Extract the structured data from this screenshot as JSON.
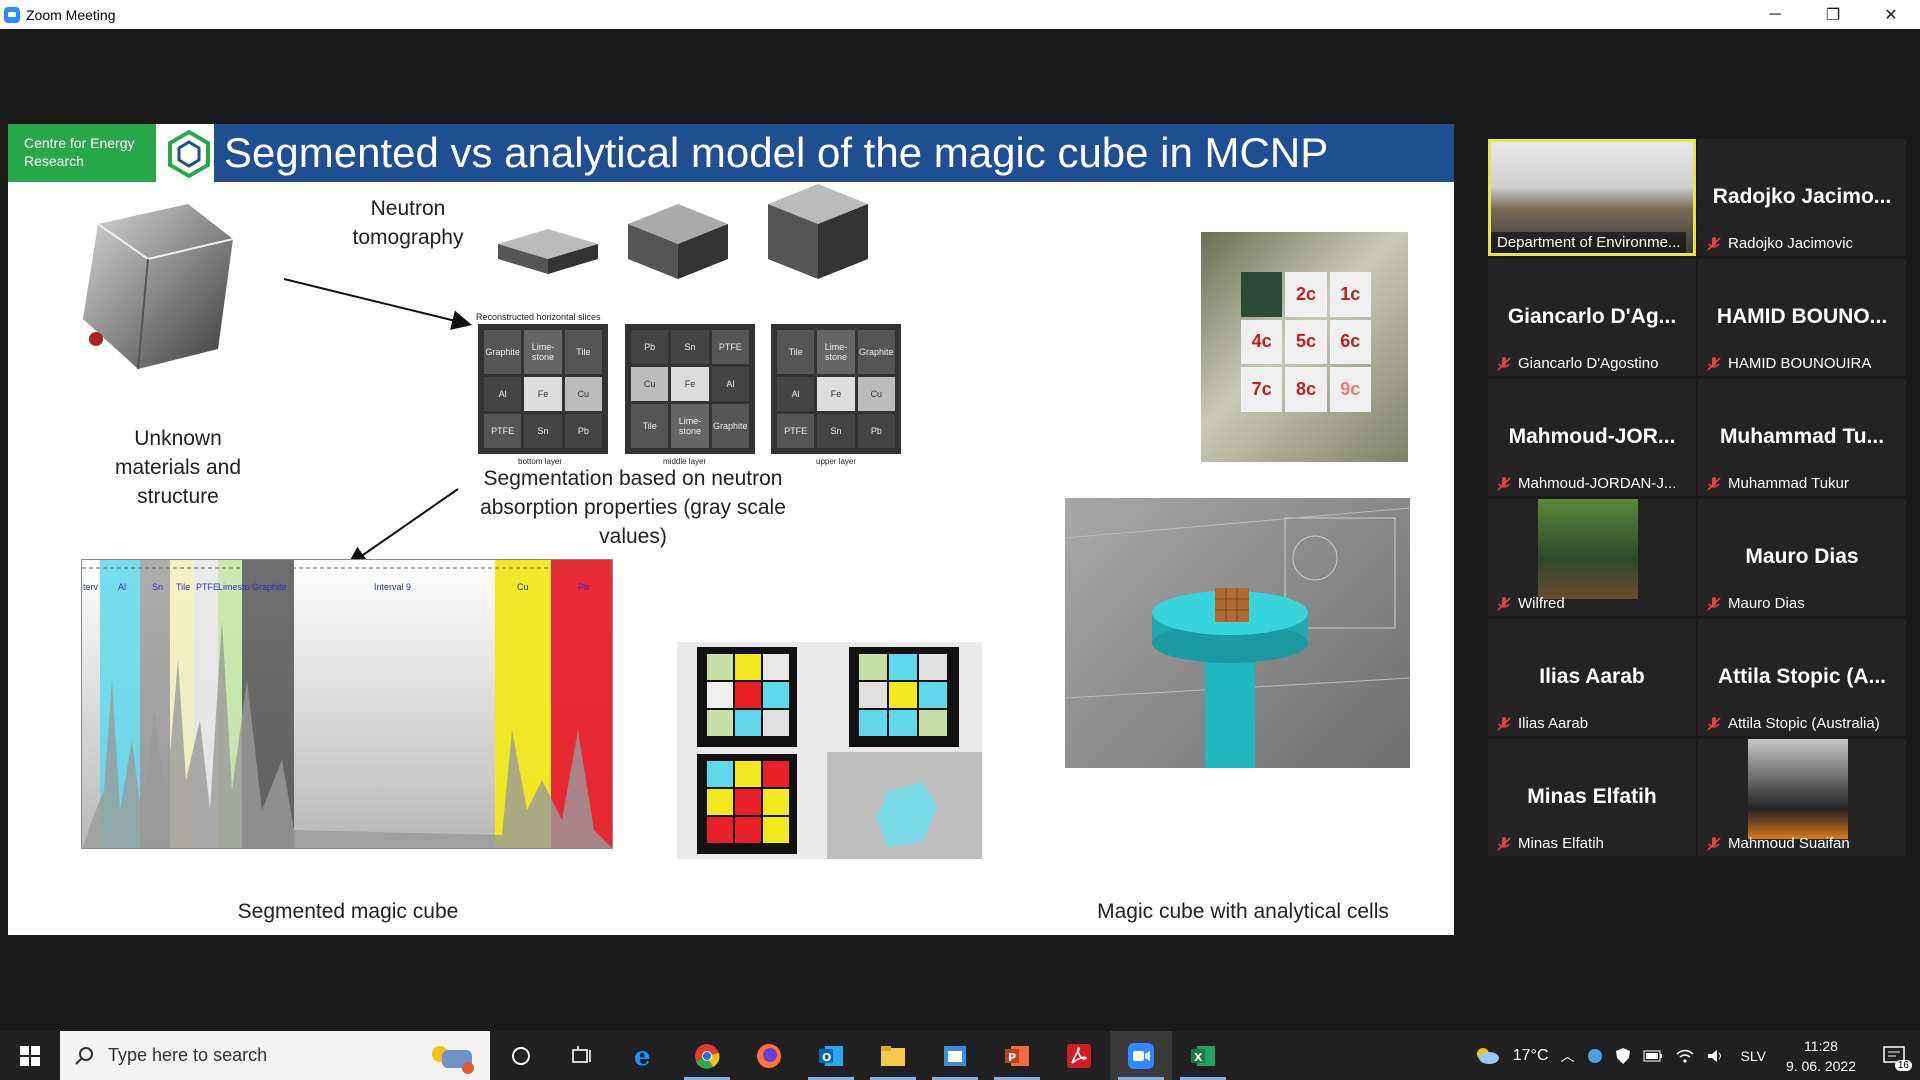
{
  "window": {
    "title": "Zoom Meeting",
    "controls": {
      "minimize": "─",
      "restore": "❐",
      "close": "✕"
    }
  },
  "slide": {
    "org_badge": "Centre for Energy Research",
    "title": "Segmented vs analytical model of the magic cube in MCNP",
    "neutron_tomography": "Neutron tomography",
    "unknown_materials": "Unknown materials and structure",
    "reconstructed_slices": "Reconstructed horizontal slices",
    "segmentation_text": "Segmentation based on neutron absorption properties (gray scale values)",
    "layers": [
      "bottom layer",
      "middle layer",
      "upper layer"
    ],
    "grid_bottom": [
      "Graphite",
      "Lime-stone",
      "Tile",
      "Al",
      "Fe",
      "Cu",
      "PTFE",
      "Sn",
      "Pb"
    ],
    "grid_middle": [
      "Pb",
      "Sn",
      "PTFE",
      "Cu",
      "Fe",
      "Al",
      "Tile",
      "Lime-stone",
      "Graphite"
    ],
    "grid_upper": [
      "Tile",
      "Lime-stone",
      "Graphite",
      "Al",
      "Fe",
      "Cu",
      "PTFE",
      "Sn",
      "Pb"
    ],
    "histogram_labels": [
      "terv",
      "Al",
      "Sn",
      "Tile",
      "PTFE",
      "Limesto",
      "Graphite",
      "Interval 9",
      "Cu",
      "Pb"
    ],
    "cube_labels": [
      "2c",
      "1c",
      "4c",
      "5c",
      "6c",
      "7c",
      "8c",
      "9c"
    ],
    "segmented_caption": "Segmented magic cube",
    "analytical_caption": "Magic cube with analytical cells"
  },
  "participants": [
    {
      "big": "",
      "name": "Department of Environme...",
      "video": true,
      "active": true,
      "muted": false
    },
    {
      "big": "Radojko Jacimo...",
      "name": "Radojko Jacimovic",
      "video": false,
      "muted": true
    },
    {
      "big": "Giancarlo D'Ag...",
      "name": "Giancarlo D'Agostino",
      "video": false,
      "muted": true
    },
    {
      "big": "HAMID BOUNO...",
      "name": "HAMID BOUNOUIRA",
      "video": false,
      "muted": true
    },
    {
      "big": "Mahmoud-JOR...",
      "name": "Mahmoud-JORDAN-J...",
      "video": false,
      "muted": true
    },
    {
      "big": "Muhammad Tu...",
      "name": "Muhammad Tukur",
      "video": false,
      "muted": true
    },
    {
      "big": "",
      "name": "Wilfred",
      "video": true,
      "muted": true
    },
    {
      "big": "Mauro Dias",
      "name": "Mauro Dias",
      "video": false,
      "muted": true
    },
    {
      "big": "Ilias Aarab",
      "name": "Ilias Aarab",
      "video": false,
      "muted": true
    },
    {
      "big": "Attila Stopic (A...",
      "name": "Attila Stopic (Australia)",
      "video": false,
      "muted": true
    },
    {
      "big": "Minas Elfatih",
      "name": "Minas Elfatih",
      "video": false,
      "muted": true
    },
    {
      "big": "",
      "name": "Mahmoud Suaifan",
      "video": true,
      "muted": true
    }
  ],
  "taskbar": {
    "search_placeholder": "Type here to search",
    "temperature": "17°C",
    "language": "SLV",
    "time": "11:28",
    "date": "9. 06. 2022",
    "notifications": "16"
  },
  "colors": {
    "slide_title_bg": "#1f4f8f",
    "org_badge_bg": "#29a84a",
    "active_speaker": "#e5e54a",
    "muted_mic": "#e04040"
  }
}
